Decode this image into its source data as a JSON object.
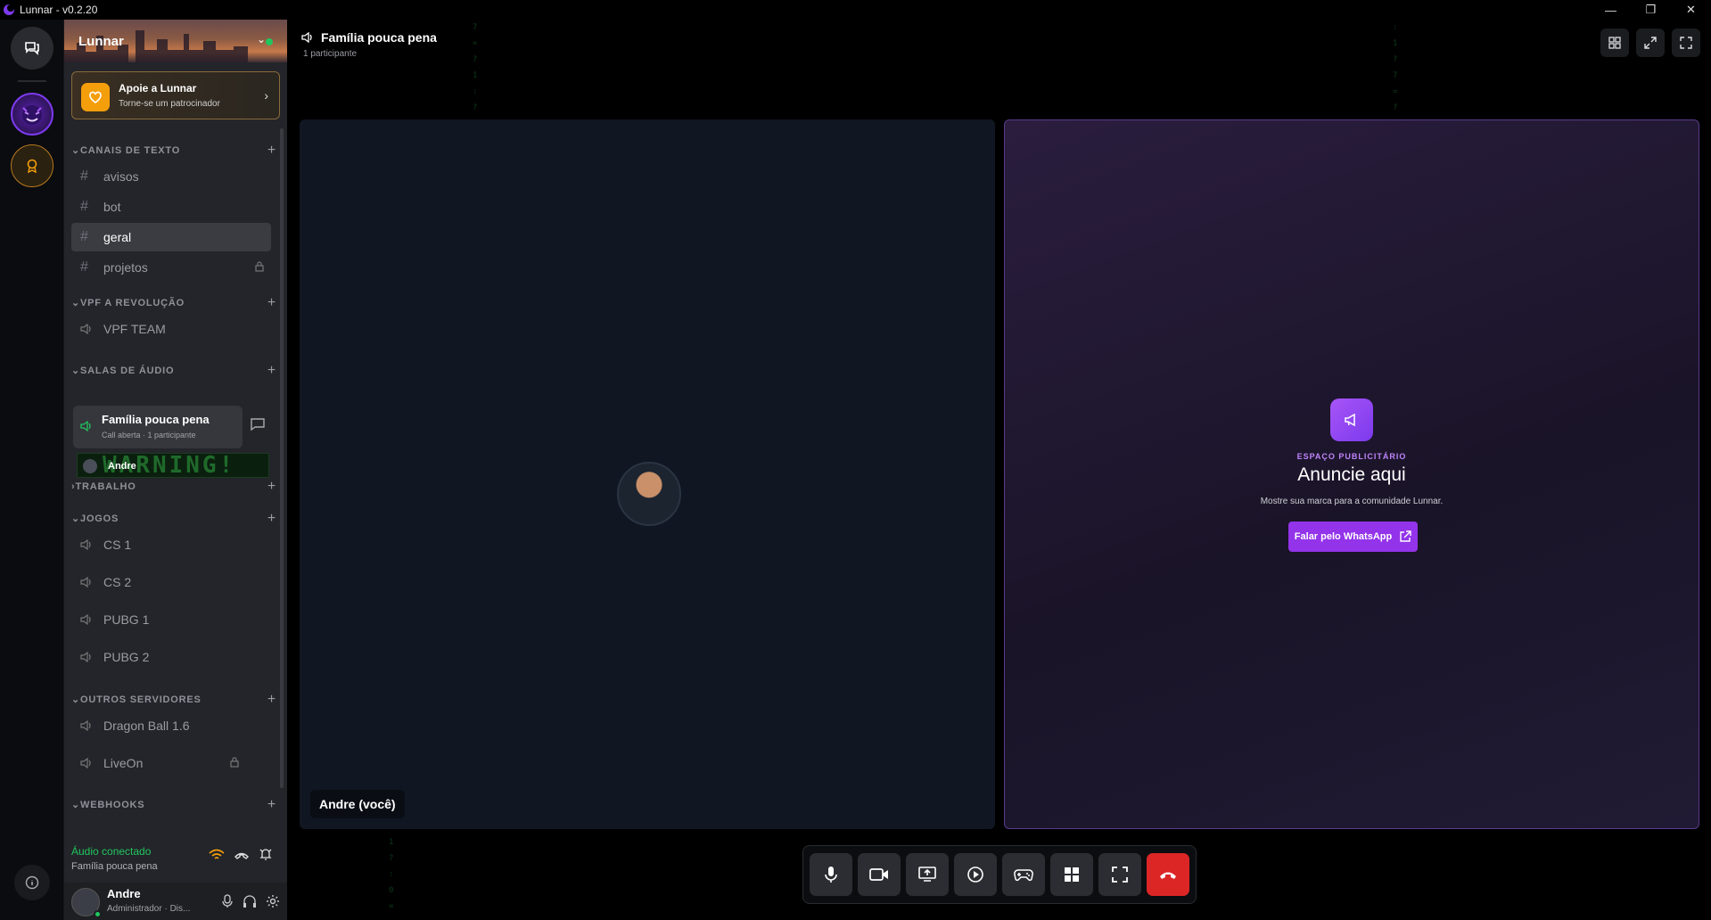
{
  "window": {
    "title": "Lunnar - v0.2.20"
  },
  "server": {
    "name": "Lunnar",
    "support": {
      "title": "Apoie a Lunnar",
      "subtitle": "Torne-se um patrocinador"
    },
    "categories": [
      {
        "label": "CANAIS DE TEXTO",
        "expanded": true
      },
      {
        "label": "VPF A REVOLUÇÃO",
        "expanded": true
      },
      {
        "label": "SALAS DE ÁUDIO",
        "expanded": true
      },
      {
        "label": "TRABALHO",
        "expanded": false
      },
      {
        "label": "JOGOS",
        "expanded": true
      },
      {
        "label": "OUTROS SERVIDORES",
        "expanded": true
      },
      {
        "label": "WEBHOOKS",
        "expanded": true
      }
    ],
    "text_channels": [
      {
        "label": "avisos"
      },
      {
        "label": "bot"
      },
      {
        "label": "geral",
        "active": true
      },
      {
        "label": "projetos",
        "locked": true
      }
    ],
    "vpf_channels": [
      {
        "label": "VPF TEAM"
      }
    ],
    "audio_room": {
      "name": "Família pouca pena",
      "status": "Call aberta · 1 participante"
    },
    "audio_member": {
      "name": "Andre",
      "banner_text": "WARNING!"
    },
    "games_channels": [
      {
        "label": "CS 1"
      },
      {
        "label": "CS 2"
      },
      {
        "label": "PUBG 1"
      },
      {
        "label": "PUBG 2"
      }
    ],
    "other_channels": [
      {
        "label": "Dragon Ball 1.6"
      },
      {
        "label": "LiveOn",
        "locked": true
      }
    ]
  },
  "connection": {
    "status": "Áudio conectado",
    "room": "Família pouca pena"
  },
  "user": {
    "name": "Andre",
    "role": "Administrador · Dis..."
  },
  "call": {
    "title": "Família pouca pena",
    "participants": "1 participante",
    "self_label": "Andre (você)"
  },
  "ad": {
    "kicker": "ESPAÇO PUBLICITÁRIO",
    "headline": "Anuncie aqui",
    "description": "Mostre sua marca para a comunidade Lunnar.",
    "cta": "Falar pelo WhatsApp"
  },
  "colors": {
    "accent": "#9333ea",
    "online": "#22c55e",
    "danger": "#dc2626",
    "support": "#f59e0b"
  },
  "icons": [
    "chat-icon",
    "gear-icon",
    "mic-icon",
    "camera-icon",
    "screen-share-icon",
    "play-icon",
    "gamepad-icon",
    "grid-icon",
    "fullscreen-icon",
    "hangup-icon"
  ]
}
